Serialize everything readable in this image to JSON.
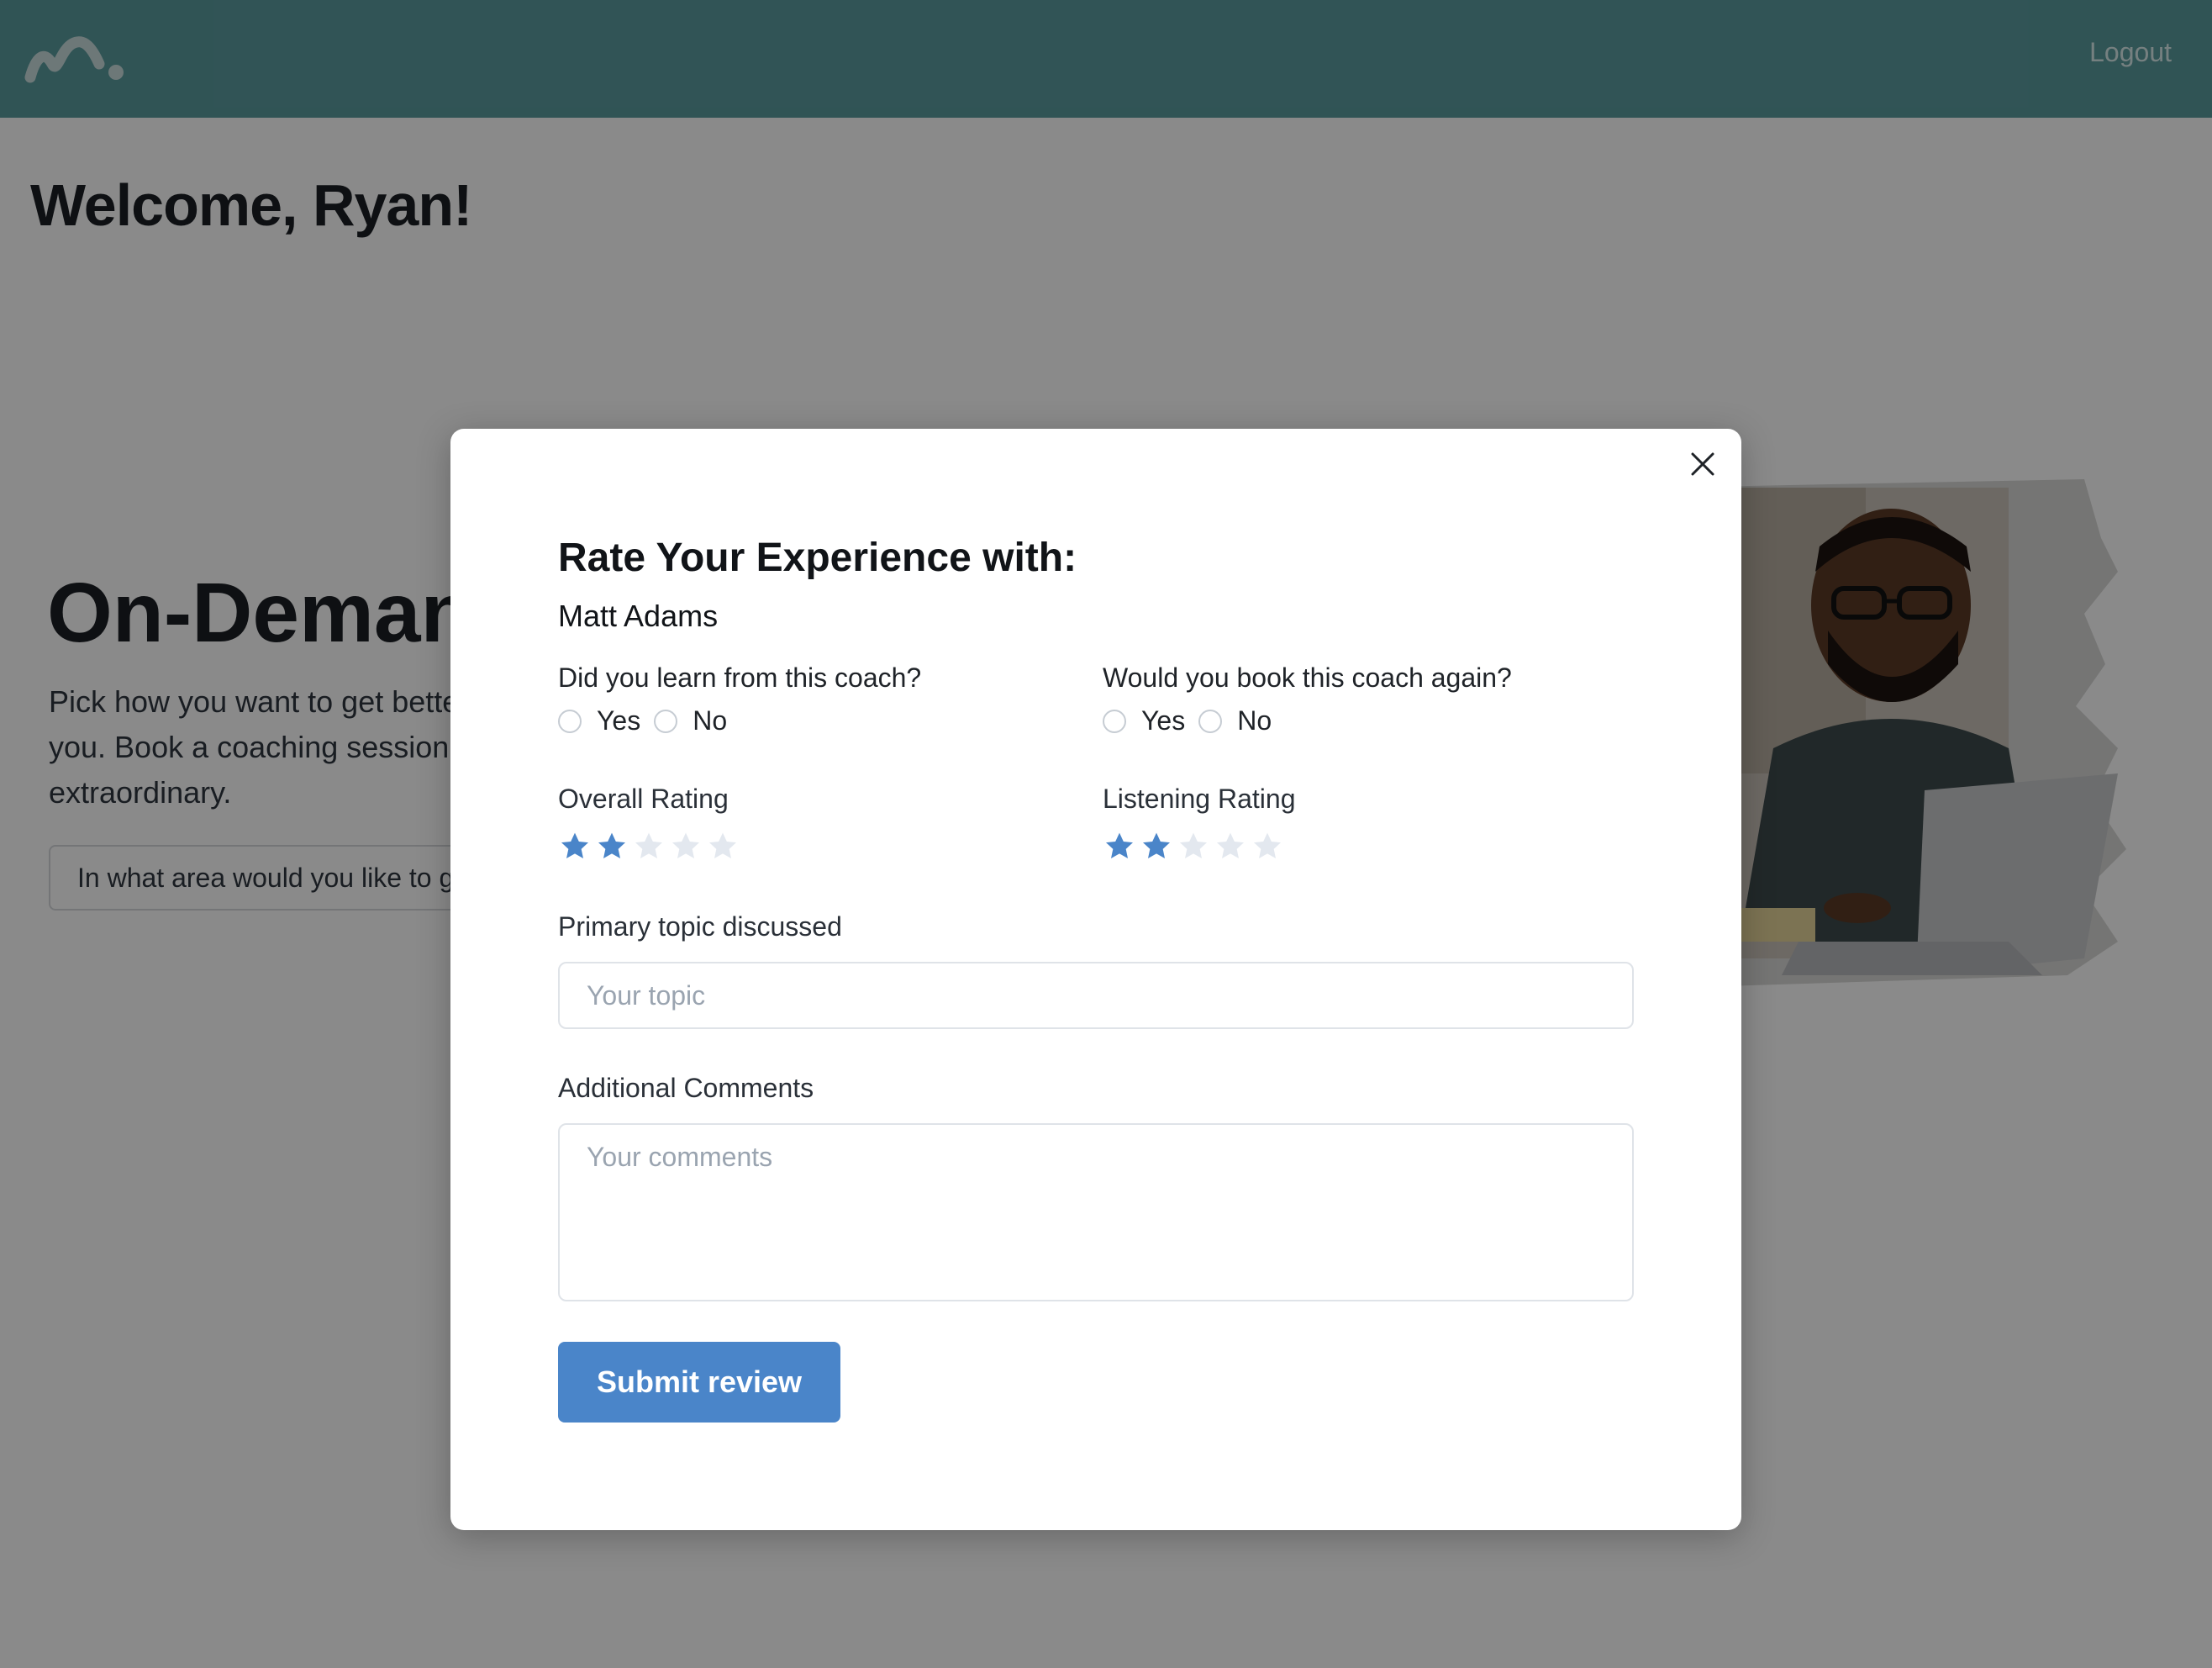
{
  "header": {
    "logout_label": "Logout",
    "background_color": "#5a9b9e"
  },
  "main": {
    "welcome": "Welcome, Ryan!",
    "hero_title": "On-Demand",
    "hero_text": "Pick how you want to get better and we'll find a coach to help you. Book a coaching session and turn the ordinary into extraordinary.",
    "area_select_value": "In what area would you like to grow?"
  },
  "modal": {
    "title": "Rate Your Experience with:",
    "coach_name": "Matt Adams",
    "learn_question": {
      "label": "Did you learn from this coach?",
      "options": [
        "Yes",
        "No"
      ],
      "selected": null
    },
    "book_question": {
      "label": "Would you book this coach again?",
      "options": [
        "Yes",
        "No"
      ],
      "selected": null
    },
    "overall_rating": {
      "label": "Overall Rating",
      "value": 2,
      "max": 5
    },
    "listening_rating": {
      "label": "Listening Rating",
      "value": 2,
      "max": 5
    },
    "topic": {
      "label": "Primary topic discussed",
      "placeholder": "Your topic",
      "value": ""
    },
    "comments": {
      "label": "Additional Comments",
      "placeholder": "Your comments",
      "value": ""
    },
    "submit_label": "Submit review",
    "close_icon": "close-icon"
  },
  "colors": {
    "accent": "#4a85c9",
    "star_filled": "#4a85c9",
    "star_empty": "#e3e8ef",
    "overlay": "rgba(0,0,0,0.46)"
  }
}
